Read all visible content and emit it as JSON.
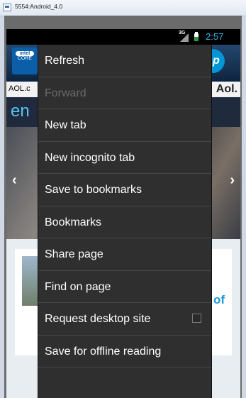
{
  "window": {
    "title": "5554:Android_4.0"
  },
  "status_bar": {
    "network": "3G",
    "time": "2:57"
  },
  "background_page": {
    "ad_left_brand": "intel",
    "ad_left_sub": "CORE",
    "ad_right_brand": "hp",
    "aol_left": "AOL.c",
    "aol_right": "Aol.",
    "nav_text": "en",
    "arrow_left": "‹",
    "arrow_right": "›",
    "card_partial_text": "of"
  },
  "menu": {
    "items": [
      {
        "label": "Refresh",
        "enabled": true
      },
      {
        "label": "Forward",
        "enabled": false
      },
      {
        "label": "New tab",
        "enabled": true
      },
      {
        "label": "New incognito tab",
        "enabled": true
      },
      {
        "label": "Save to bookmarks",
        "enabled": true
      },
      {
        "label": "Bookmarks",
        "enabled": true
      },
      {
        "label": "Share page",
        "enabled": true
      },
      {
        "label": "Find on page",
        "enabled": true
      },
      {
        "label": "Request desktop site",
        "enabled": true,
        "checkbox": false
      },
      {
        "label": "Save for offline reading",
        "enabled": true
      }
    ]
  },
  "colors": {
    "menu_background": "#2f2f2f",
    "menu_divider": "#484848",
    "menu_text": "#ffffff",
    "menu_text_disabled": "#6a6a6a",
    "clock_accent": "#34b5e5",
    "emulator_frame": "#6b6b6b"
  }
}
